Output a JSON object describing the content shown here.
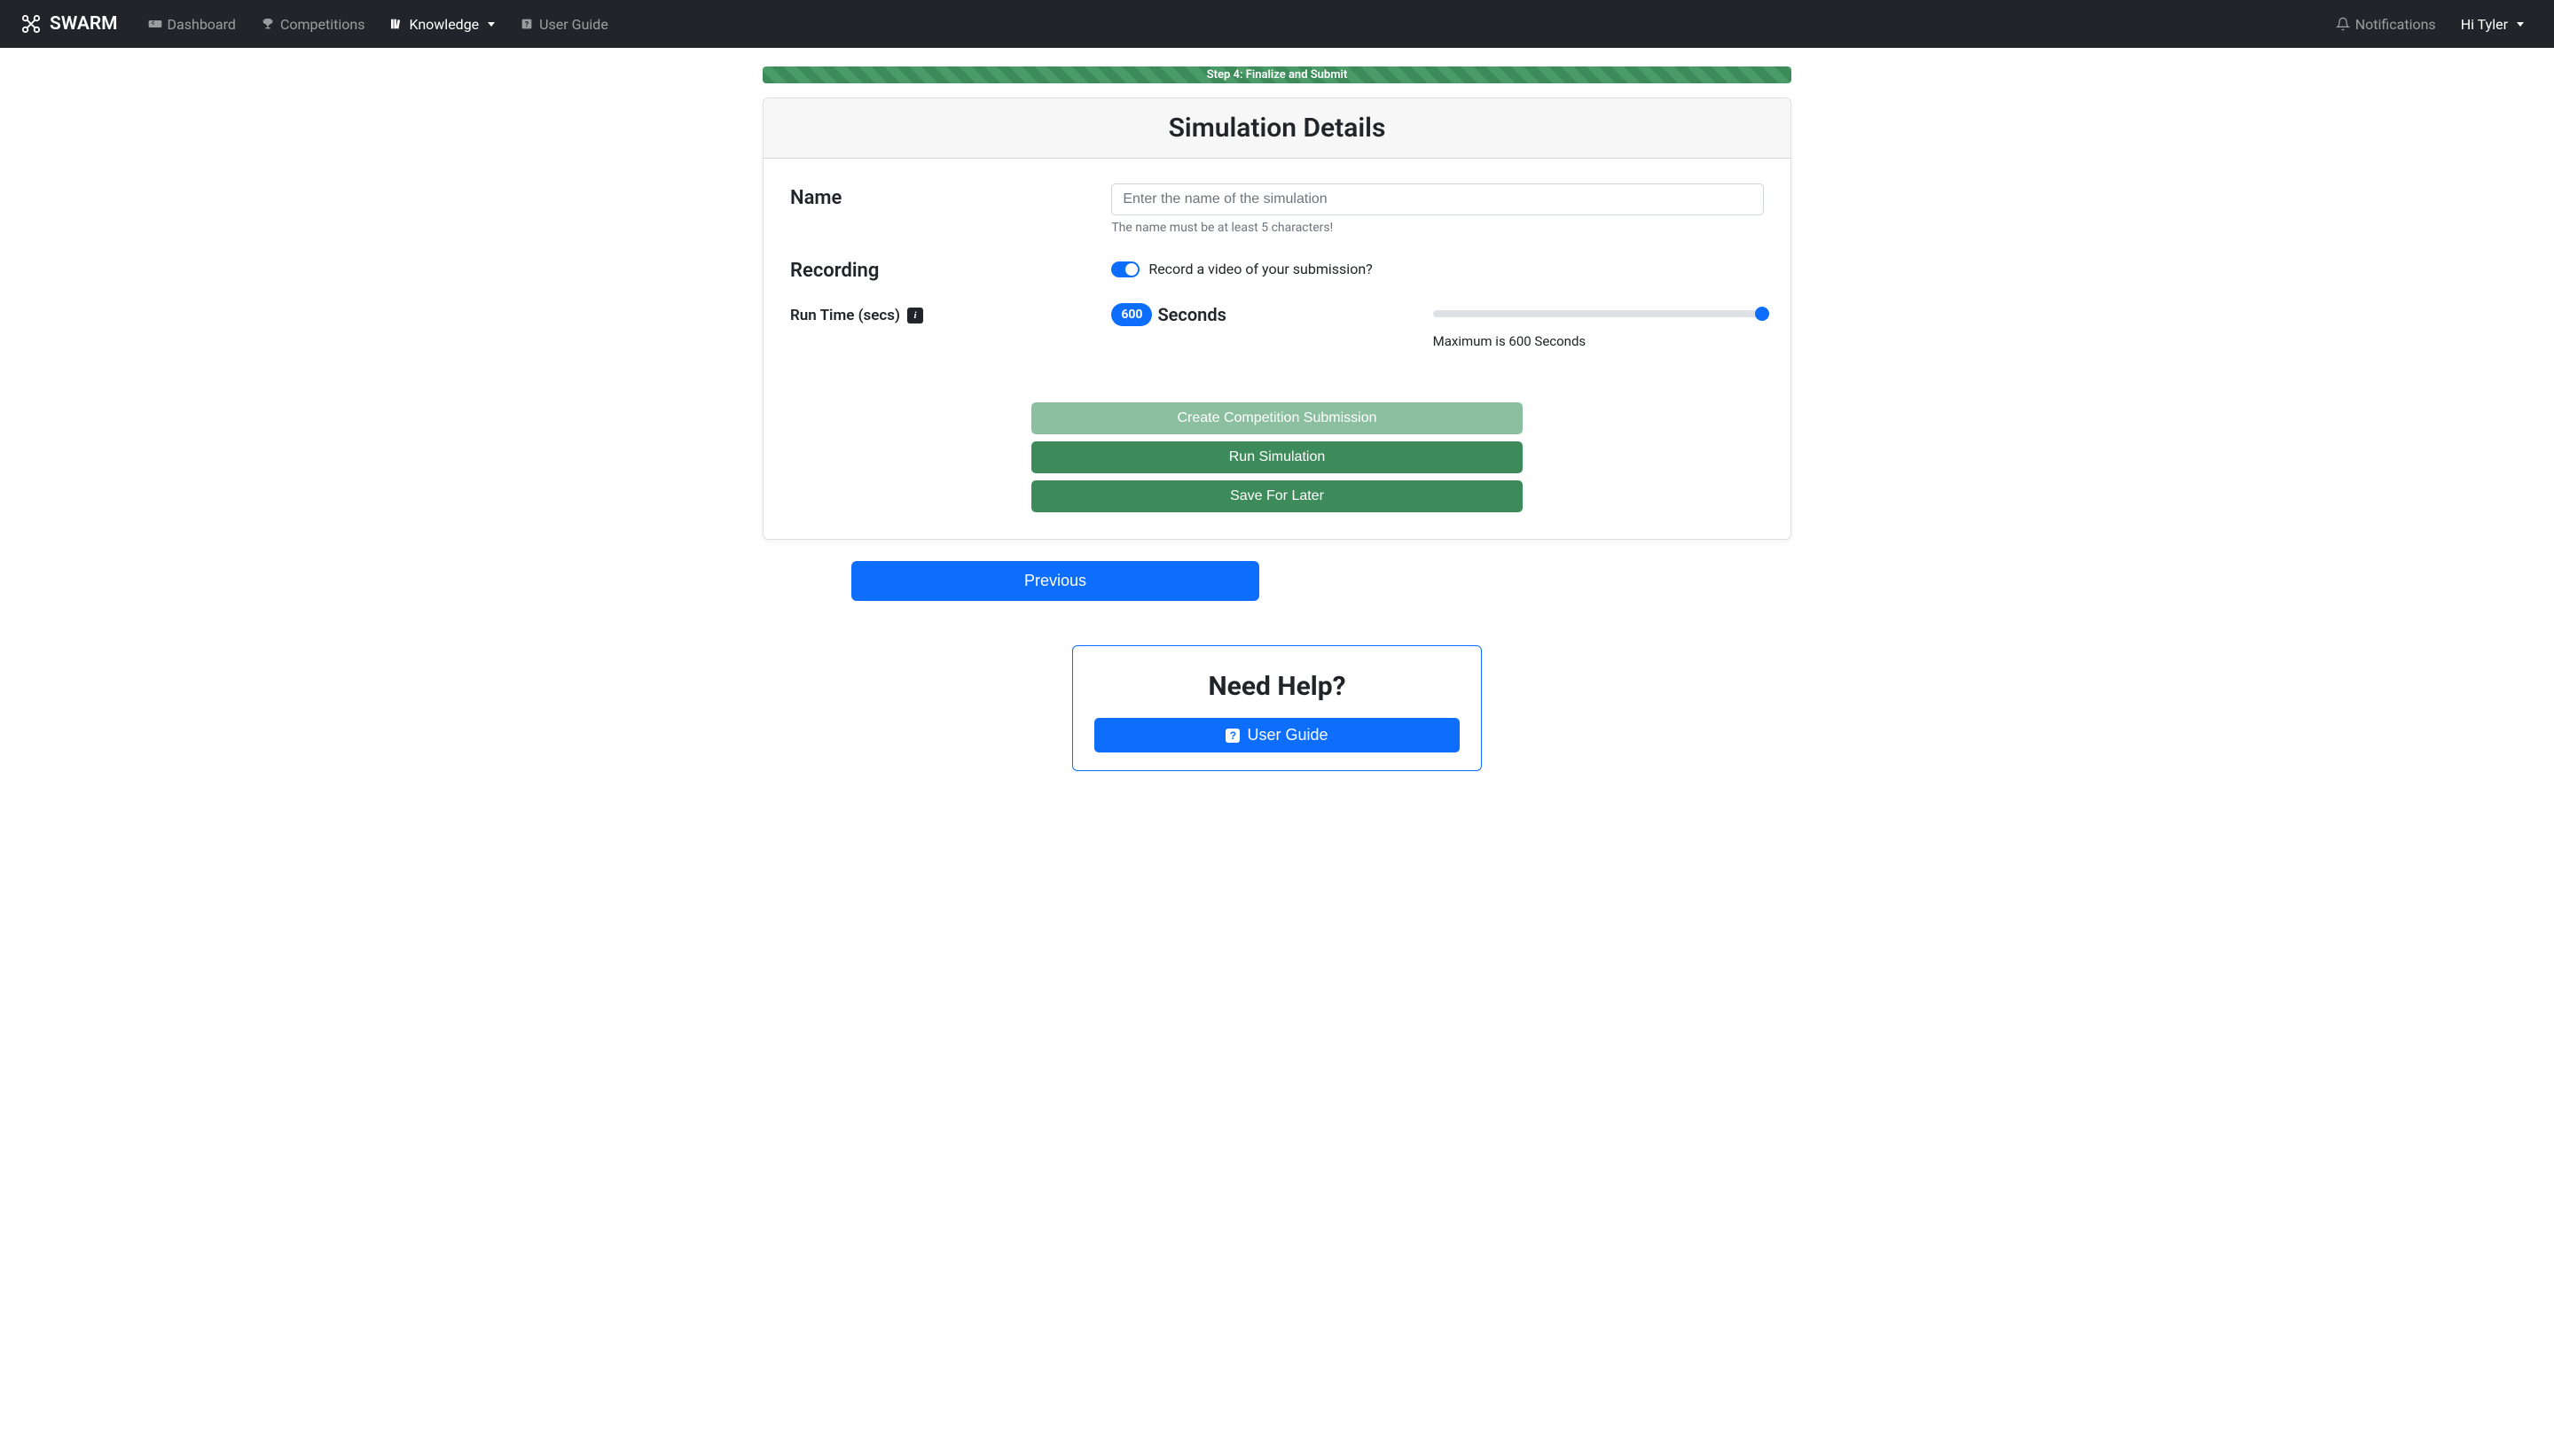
{
  "navbar": {
    "brand": "SWARM",
    "links": {
      "dashboard": "Dashboard",
      "competitions": "Competitions",
      "knowledge": "Knowledge",
      "user_guide": "User Guide"
    },
    "notifications": "Notifications",
    "user_greeting": "Hi Tyler"
  },
  "progress": {
    "step_label": "Step 4: Finalize and Submit"
  },
  "card": {
    "title": "Simulation Details",
    "name": {
      "label": "Name",
      "placeholder": "Enter the name of the simulation",
      "hint": "The name must be at least 5 characters!"
    },
    "recording": {
      "label": "Recording",
      "toggle_label": "Record a video of your submission?"
    },
    "runtime": {
      "label": "Run Time (secs)",
      "value": "600",
      "unit": "Seconds",
      "hint": "Maximum is 600 Seconds"
    },
    "buttons": {
      "create": "Create Competition Submission",
      "run": "Run Simulation",
      "save": "Save For Later"
    }
  },
  "previous_button": "Previous",
  "help": {
    "title": "Need Help?",
    "button": "User Guide"
  }
}
